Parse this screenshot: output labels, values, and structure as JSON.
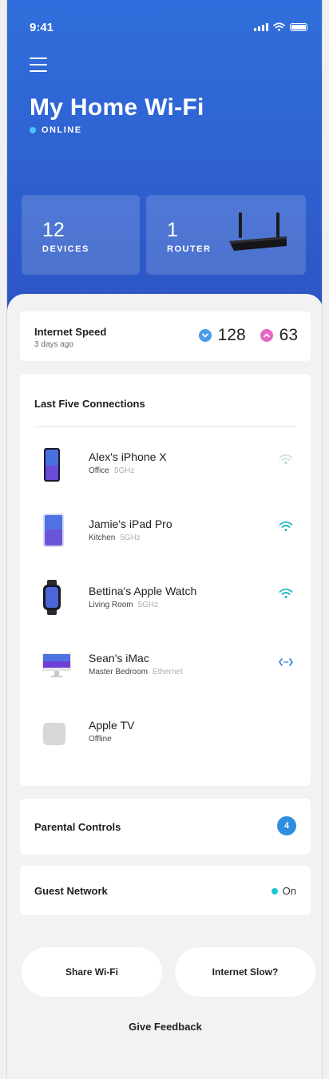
{
  "status_bar": {
    "time": "9:41"
  },
  "header": {
    "title": "My Home Wi-Fi",
    "status": "ONLINE",
    "status_color": "#45c6ff"
  },
  "tiles": {
    "devices": {
      "count": "12",
      "label": "DEVICES"
    },
    "router": {
      "count": "1",
      "label": "ROUTER"
    }
  },
  "speed": {
    "label": "Internet Speed",
    "updated": "3 days ago",
    "download": "128",
    "upload": "63",
    "download_color": "#4a9ce8",
    "upload_color": "#e566c4"
  },
  "connections": {
    "heading": "Last Five Connections",
    "items": [
      {
        "name": "Alex's iPhone X",
        "location": "Office",
        "band": "5GHz",
        "device_icon": "phone-icon",
        "link_icon": "wifi-weak-icon"
      },
      {
        "name": "Jamie's iPad Pro",
        "location": "Kitchen",
        "band": "5GHz",
        "device_icon": "tablet-icon",
        "link_icon": "wifi-icon"
      },
      {
        "name": "Bettina's Apple Watch",
        "location": "Living Room",
        "band": "5GHz",
        "device_icon": "watch-icon",
        "link_icon": "wifi-icon"
      },
      {
        "name": "Sean's iMac",
        "location": "Master Bedroom",
        "band": "Ethernet",
        "device_icon": "monitor-icon",
        "link_icon": "ethernet-icon"
      },
      {
        "name": "Apple TV",
        "location": "Offline",
        "band": "",
        "device_icon": "tv-box-icon",
        "link_icon": ""
      }
    ]
  },
  "parental_controls": {
    "label": "Parental Controls",
    "count": "4"
  },
  "guest_network": {
    "label": "Guest Network",
    "state": "On",
    "state_color": "#1dc5d8"
  },
  "actions": {
    "share_wifi": "Share Wi-Fi",
    "internet_slow": "Internet Slow?",
    "feedback": "Give Feedback"
  }
}
